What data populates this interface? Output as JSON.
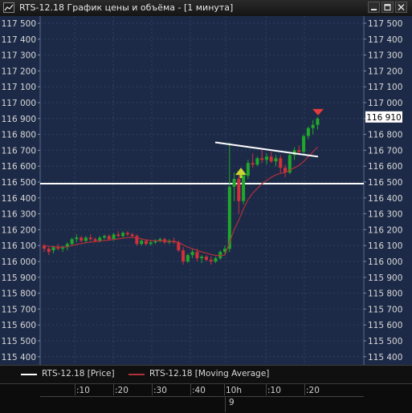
{
  "window": {
    "title": "RTS-12.18 График цены и объёма - [1 минута]"
  },
  "price_axis": {
    "labels": [
      "117 500",
      "117 400",
      "117 300",
      "117 200",
      "117 100",
      "117 000",
      "116 900",
      "116 800",
      "116 700",
      "116 600",
      "116 500",
      "116 400",
      "116 300",
      "116 200",
      "116 100",
      "116 000",
      "115 900",
      "115 800",
      "115 700",
      "115 600",
      "115 500",
      "115 400"
    ],
    "current_price": "116 910"
  },
  "legend": {
    "price_label": "RTS-12.18 [Price]",
    "ma_label": "RTS-12.18 [Moving Average]"
  },
  "time_axis": {
    "labels": [
      ":10",
      ":20",
      ":30",
      ":40",
      "10h",
      ":10",
      ":20"
    ],
    "date_label": "9"
  },
  "colors": {
    "background": "#1d2a47",
    "grid": "#2e3f63",
    "up_candle": "#1fa82a",
    "down_candle": "#d2303a",
    "moving_average": "#b0303a",
    "level_line": "#ffffff"
  },
  "chart_data": {
    "type": "candlestick",
    "ylim": [
      115400,
      117500
    ],
    "price_levels": [
      116490
    ],
    "trend_lines": [
      [
        116750,
        116660
      ]
    ],
    "buy_marker_price": 116560,
    "sell_marker_price": 116940,
    "candles": [
      {
        "o": 116100,
        "h": 116110,
        "l": 116060,
        "c": 116080
      },
      {
        "o": 116080,
        "h": 116090,
        "l": 116040,
        "c": 116060
      },
      {
        "o": 116070,
        "h": 116100,
        "l": 116050,
        "c": 116090
      },
      {
        "o": 116090,
        "h": 116110,
        "l": 116070,
        "c": 116080
      },
      {
        "o": 116080,
        "h": 116100,
        "l": 116060,
        "c": 116090
      },
      {
        "o": 116090,
        "h": 116120,
        "l": 116070,
        "c": 116110
      },
      {
        "o": 116110,
        "h": 116150,
        "l": 116100,
        "c": 116140
      },
      {
        "o": 116140,
        "h": 116170,
        "l": 116120,
        "c": 116150
      },
      {
        "o": 116150,
        "h": 116160,
        "l": 116120,
        "c": 116130
      },
      {
        "o": 116130,
        "h": 116160,
        "l": 116120,
        "c": 116150
      },
      {
        "o": 116150,
        "h": 116170,
        "l": 116130,
        "c": 116140
      },
      {
        "o": 116140,
        "h": 116150,
        "l": 116120,
        "c": 116130
      },
      {
        "o": 116130,
        "h": 116160,
        "l": 116120,
        "c": 116150
      },
      {
        "o": 116150,
        "h": 116170,
        "l": 116140,
        "c": 116160
      },
      {
        "o": 116160,
        "h": 116170,
        "l": 116130,
        "c": 116140
      },
      {
        "o": 116140,
        "h": 116180,
        "l": 116130,
        "c": 116170
      },
      {
        "o": 116170,
        "h": 116190,
        "l": 116150,
        "c": 116160
      },
      {
        "o": 116160,
        "h": 116190,
        "l": 116150,
        "c": 116180
      },
      {
        "o": 116180,
        "h": 116190,
        "l": 116160,
        "c": 116170
      },
      {
        "o": 116170,
        "h": 116180,
        "l": 116150,
        "c": 116160
      },
      {
        "o": 116160,
        "h": 116170,
        "l": 116100,
        "c": 116110
      },
      {
        "o": 116110,
        "h": 116140,
        "l": 116100,
        "c": 116130
      },
      {
        "o": 116130,
        "h": 116140,
        "l": 116100,
        "c": 116110
      },
      {
        "o": 116110,
        "h": 116130,
        "l": 116100,
        "c": 116120
      },
      {
        "o": 116120,
        "h": 116140,
        "l": 116110,
        "c": 116130
      },
      {
        "o": 116130,
        "h": 116150,
        "l": 116120,
        "c": 116140
      },
      {
        "o": 116140,
        "h": 116150,
        "l": 116110,
        "c": 116120
      },
      {
        "o": 116120,
        "h": 116140,
        "l": 116110,
        "c": 116130
      },
      {
        "o": 116130,
        "h": 116150,
        "l": 116110,
        "c": 116120
      },
      {
        "o": 116120,
        "h": 116130,
        "l": 116060,
        "c": 116070
      },
      {
        "o": 116070,
        "h": 116090,
        "l": 115980,
        "c": 116000
      },
      {
        "o": 116000,
        "h": 116050,
        "l": 115990,
        "c": 116040
      },
      {
        "o": 116040,
        "h": 116080,
        "l": 116020,
        "c": 116060
      },
      {
        "o": 116060,
        "h": 116080,
        "l": 116000,
        "c": 116020
      },
      {
        "o": 116020,
        "h": 116040,
        "l": 115990,
        "c": 116030
      },
      {
        "o": 116030,
        "h": 116040,
        "l": 116000,
        "c": 116010
      },
      {
        "o": 116010,
        "h": 116030,
        "l": 115980,
        "c": 116000
      },
      {
        "o": 116000,
        "h": 116030,
        "l": 115990,
        "c": 116020
      },
      {
        "o": 116020,
        "h": 116070,
        "l": 116010,
        "c": 116060
      },
      {
        "o": 116060,
        "h": 116100,
        "l": 116040,
        "c": 116080
      },
      {
        "o": 116080,
        "h": 116750,
        "l": 116060,
        "c": 116470
      },
      {
        "o": 116470,
        "h": 116560,
        "l": 116380,
        "c": 116520
      },
      {
        "o": 116520,
        "h": 116550,
        "l": 116300,
        "c": 116380
      },
      {
        "o": 116380,
        "h": 116560,
        "l": 116360,
        "c": 116540
      },
      {
        "o": 116540,
        "h": 116640,
        "l": 116520,
        "c": 116620
      },
      {
        "o": 116620,
        "h": 116680,
        "l": 116590,
        "c": 116610
      },
      {
        "o": 116610,
        "h": 116660,
        "l": 116600,
        "c": 116650
      },
      {
        "o": 116650,
        "h": 116700,
        "l": 116620,
        "c": 116640
      },
      {
        "o": 116640,
        "h": 116680,
        "l": 116610,
        "c": 116660
      },
      {
        "o": 116660,
        "h": 116690,
        "l": 116620,
        "c": 116630
      },
      {
        "o": 116630,
        "h": 116670,
        "l": 116600,
        "c": 116650
      },
      {
        "o": 116650,
        "h": 116670,
        "l": 116560,
        "c": 116590
      },
      {
        "o": 116590,
        "h": 116610,
        "l": 116530,
        "c": 116560
      },
      {
        "o": 116560,
        "h": 116680,
        "l": 116550,
        "c": 116670
      },
      {
        "o": 116670,
        "h": 116720,
        "l": 116640,
        "c": 116700
      },
      {
        "o": 116700,
        "h": 116730,
        "l": 116670,
        "c": 116690
      },
      {
        "o": 116690,
        "h": 116800,
        "l": 116680,
        "c": 116790
      },
      {
        "o": 116790,
        "h": 116850,
        "l": 116770,
        "c": 116840
      },
      {
        "o": 116840,
        "h": 116890,
        "l": 116800,
        "c": 116860
      },
      {
        "o": 116860,
        "h": 116910,
        "l": 116830,
        "c": 116900
      }
    ],
    "moving_average": [
      116100,
      116095,
      116093,
      116092,
      116090,
      116093,
      116100,
      116108,
      116112,
      116118,
      116122,
      116125,
      116128,
      116132,
      116135,
      116138,
      116142,
      116146,
      116150,
      116152,
      116148,
      116142,
      116136,
      116132,
      116130,
      116130,
      116128,
      116127,
      116126,
      116120,
      116105,
      116090,
      116080,
      116070,
      116060,
      116052,
      116044,
      116038,
      116036,
      116040,
      116120,
      116200,
      116260,
      116330,
      116390,
      116430,
      116460,
      116490,
      116510,
      116530,
      116545,
      116555,
      116560,
      116575,
      116590,
      116605,
      116630,
      116660,
      116690,
      116720
    ]
  }
}
